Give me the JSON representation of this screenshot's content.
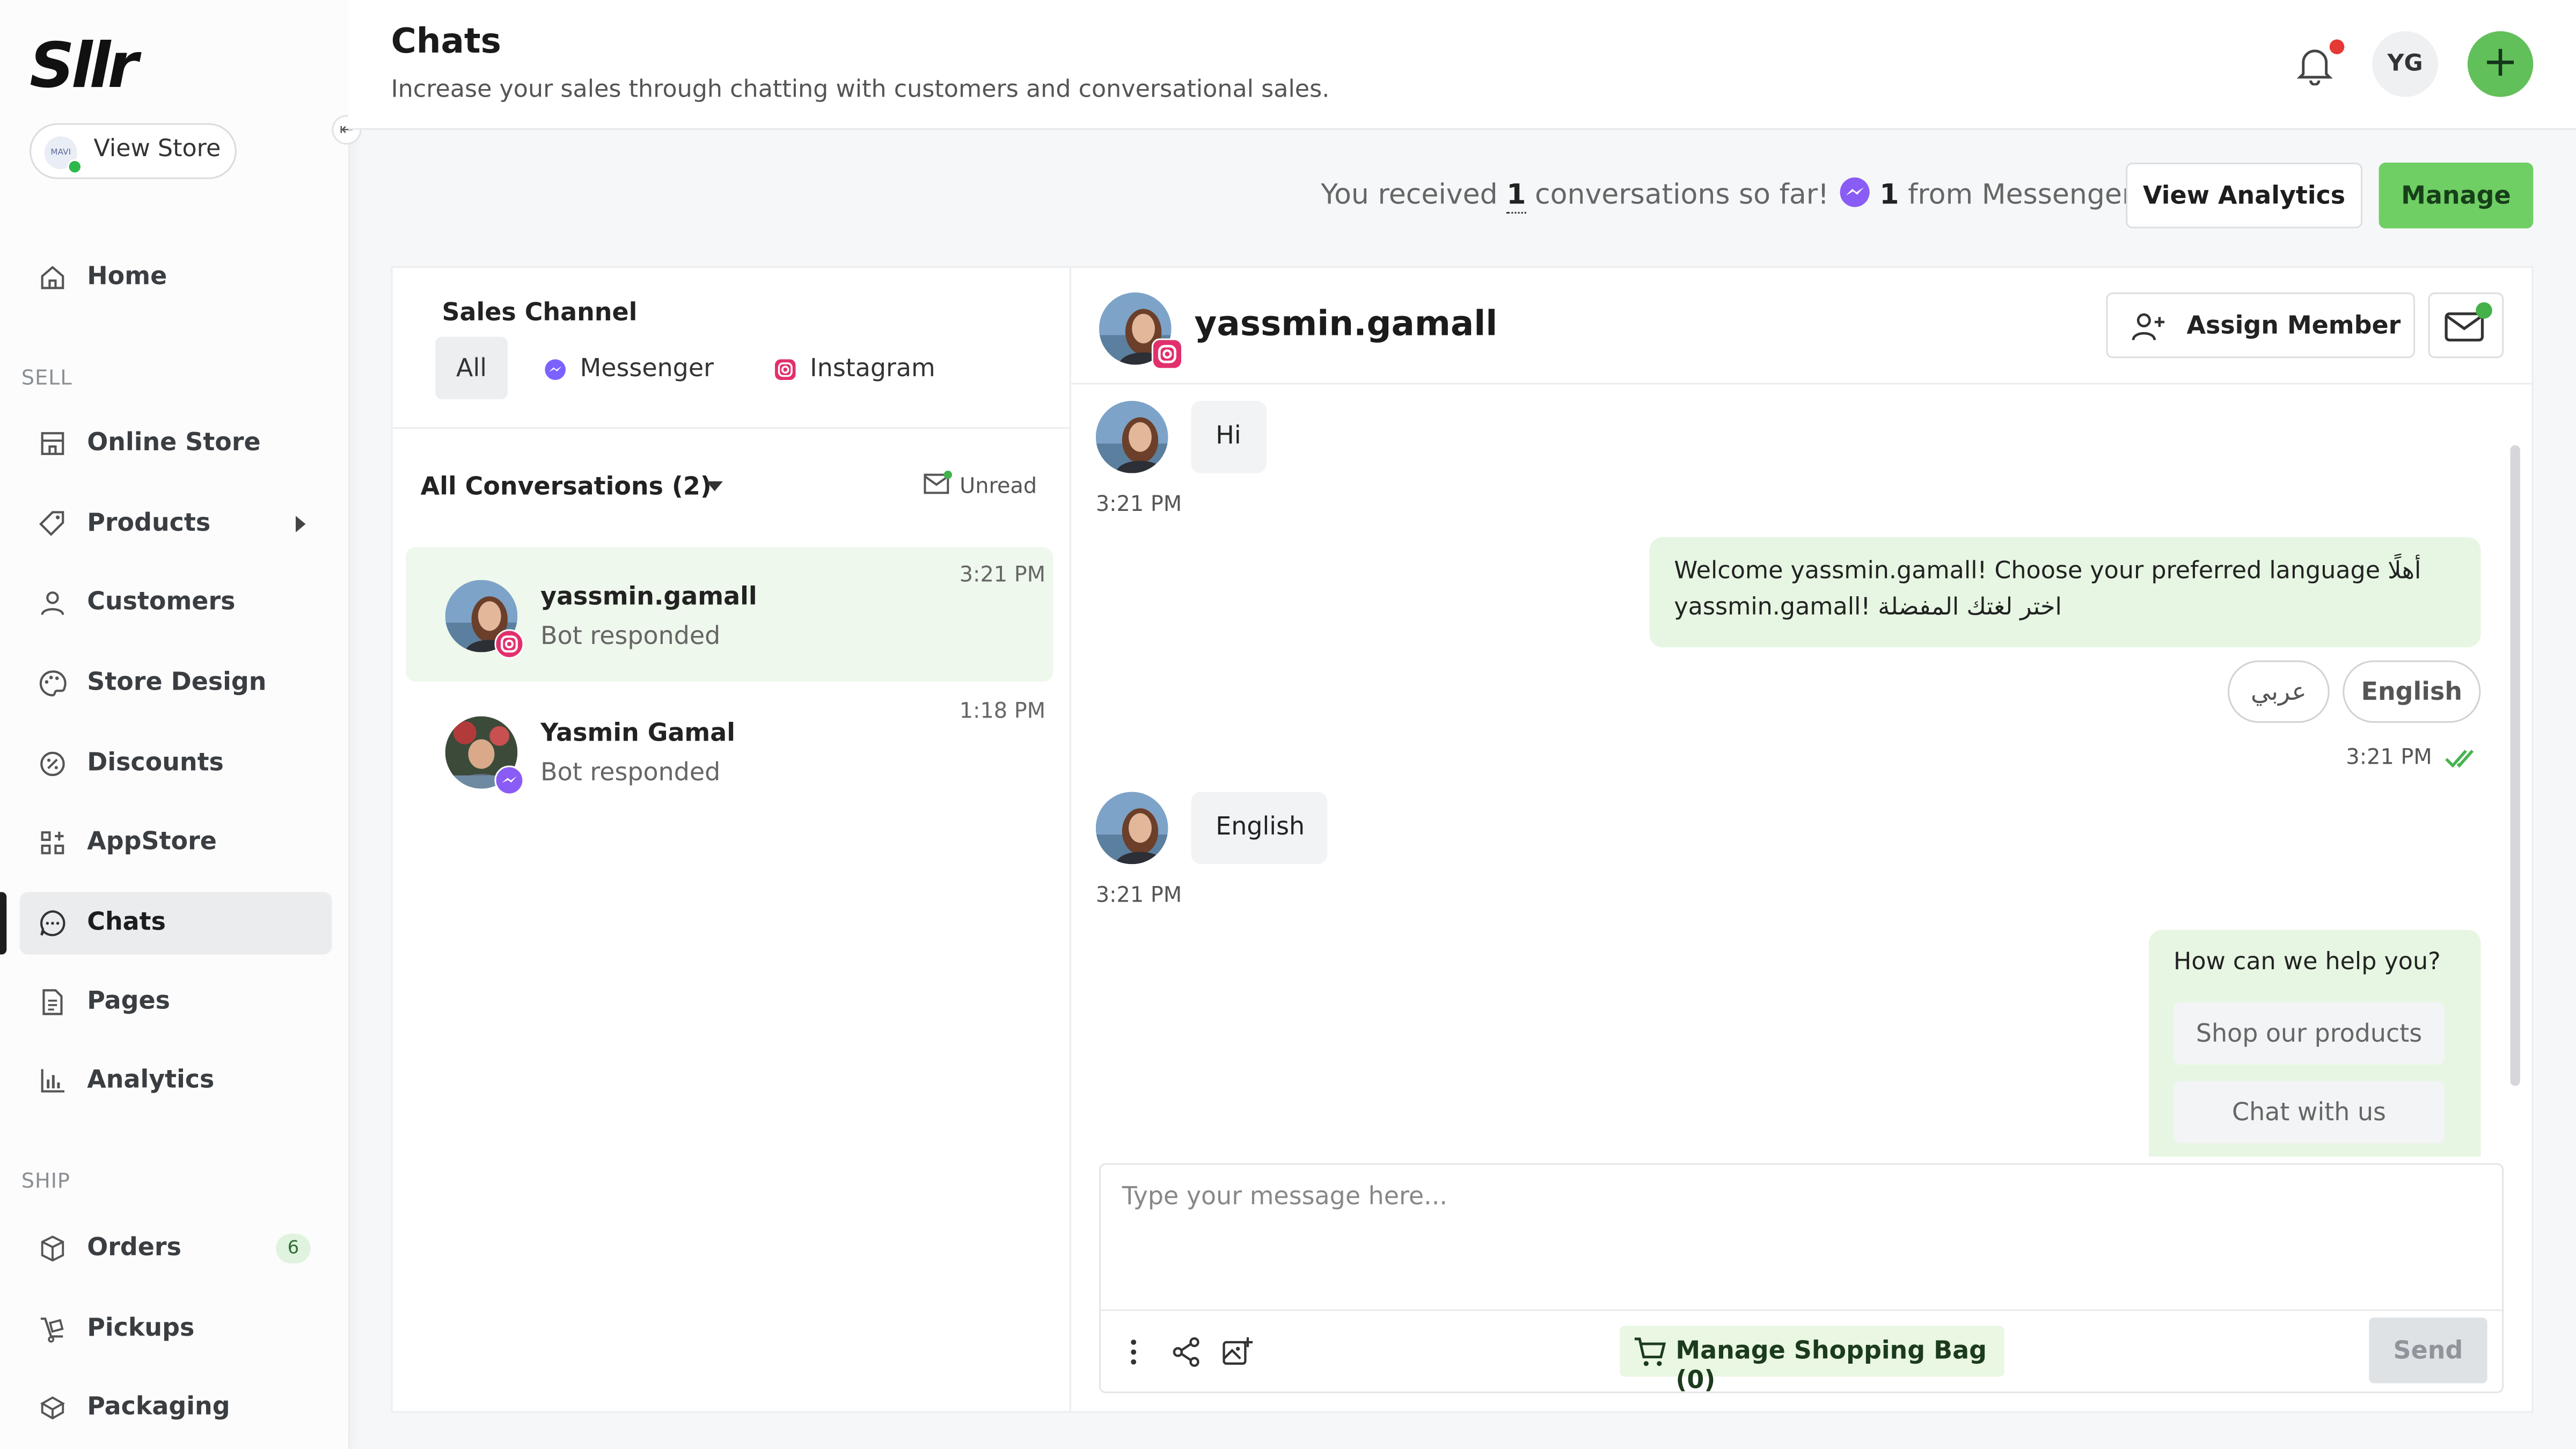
{
  "app": {
    "logo": "Sllr"
  },
  "sidebar": {
    "view_store_label": "View Store",
    "view_store_avatar_text": "MAVI",
    "sections": {
      "sell": "SELL",
      "ship": "SHIP"
    },
    "items": [
      {
        "label": "Home",
        "icon": "home-icon"
      },
      {
        "label": "Online Store",
        "icon": "store-icon"
      },
      {
        "label": "Products",
        "icon": "tag-icon"
      },
      {
        "label": "Customers",
        "icon": "user-icon"
      },
      {
        "label": "Store Design",
        "icon": "palette-icon"
      },
      {
        "label": "Discounts",
        "icon": "discount-icon"
      },
      {
        "label": "AppStore",
        "icon": "apps-grid-icon"
      },
      {
        "label": "Chats",
        "icon": "chat-icon",
        "active": true
      },
      {
        "label": "Pages",
        "icon": "page-icon"
      },
      {
        "label": "Analytics",
        "icon": "bar-chart-icon"
      },
      {
        "label": "Orders",
        "icon": "box-icon",
        "badge": "6"
      },
      {
        "label": "Pickups",
        "icon": "pickup-icon"
      },
      {
        "label": "Packaging",
        "icon": "package-icon"
      }
    ]
  },
  "header": {
    "title": "Chats",
    "subtitle": "Increase your sales through chatting with customers and conversational sales.",
    "user_initials": "YG",
    "add_label": "+"
  },
  "summary": {
    "prefix": "You received",
    "count": "1",
    "middle": "conversations so far!",
    "messenger_count": "1",
    "suffix": "from Messenger",
    "view_analytics": "View Analytics",
    "manage": "Manage"
  },
  "left_panel": {
    "sales_channel_label": "Sales Channel",
    "channels": [
      "All",
      "Messenger",
      "Instagram"
    ],
    "conversation_filter": "All Conversations (2)",
    "unread_label": "Unread",
    "conversations": [
      {
        "name": "yassmin.gamall",
        "status": "Bot responded",
        "time": "3:21 PM",
        "source": "instagram",
        "selected": true
      },
      {
        "name": "Yasmin Gamal",
        "status": "Bot responded",
        "time": "1:18 PM",
        "source": "messenger",
        "selected": false
      }
    ]
  },
  "chat": {
    "contact_name": "yassmin.gamall",
    "assign_member": "Assign Member",
    "messages": {
      "m1_text": "Hi",
      "m1_time": "3:21 PM",
      "m2_line1": "Welcome yassmin.gamall! Choose your preferred language أهلًا",
      "m2_line2": "yassmin.gamall! اختر لغتك المفضلة",
      "m2_options": [
        "عربي",
        "English"
      ],
      "m2_time": "3:21 PM",
      "m3_text": "English",
      "m3_time": "3:21 PM",
      "m4_text": "How can we help you?",
      "m4_options": [
        "Shop our products",
        "Chat with us"
      ]
    },
    "composer": {
      "placeholder": "Type your message here...",
      "shopping_bag": "Manage Shopping Bag (0)",
      "send": "Send"
    }
  },
  "colors": {
    "accent_green": "#6fcf64",
    "selected_conversation_bg": "#eef8ec",
    "outgoing_bubble": "#e6f6e2",
    "notification_dot": "#e53935"
  }
}
